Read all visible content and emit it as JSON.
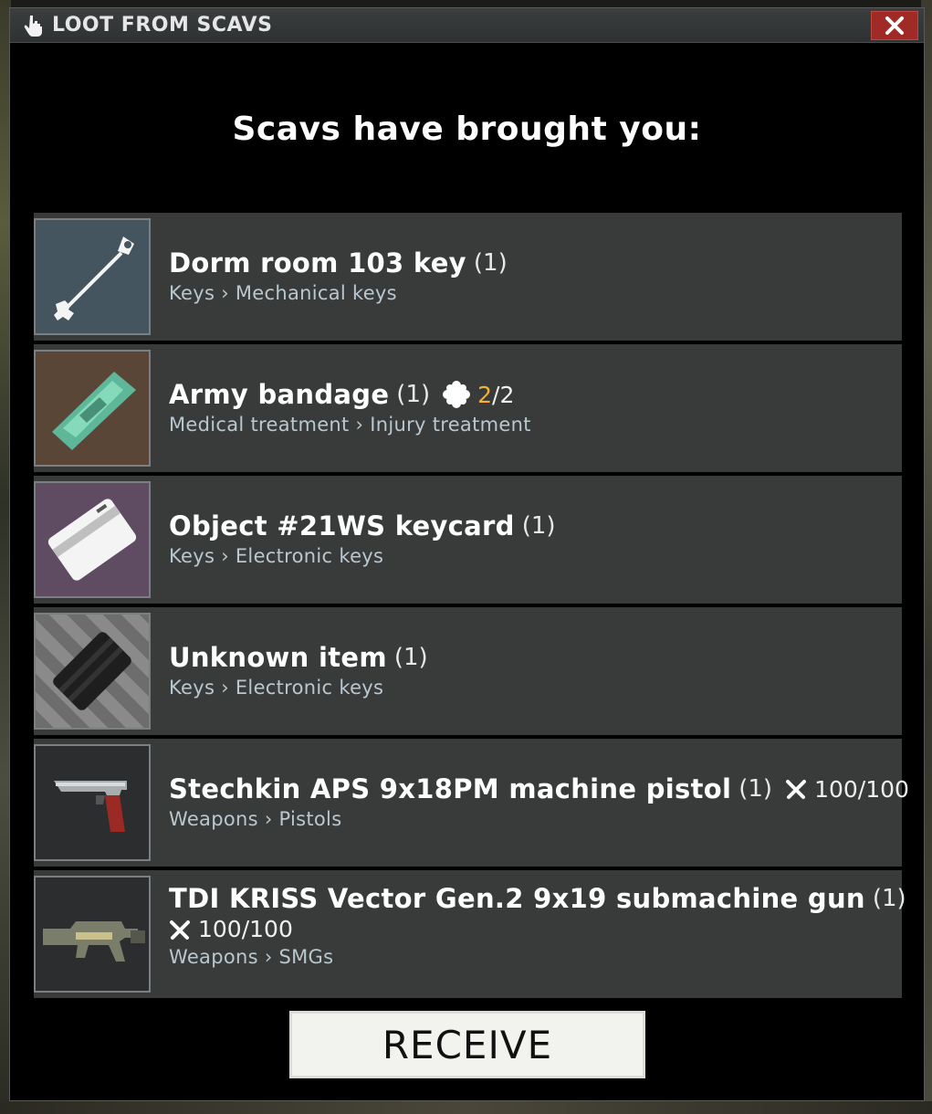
{
  "window": {
    "title": "LOOT FROM SCAVS",
    "heading": "Scavs have brought you:"
  },
  "items": [
    {
      "name": "Dorm room 103 key",
      "count": "(1)",
      "category": "Keys › Mechanical keys",
      "icon": "key-icon"
    },
    {
      "name": "Army bandage",
      "count": "(1)",
      "category": "Medical treatment › Injury treatment",
      "icon": "bandage-icon",
      "uses_current": "2",
      "uses_total": "/2"
    },
    {
      "name": "Object #21WS keycard",
      "count": "(1)",
      "category": "Keys › Electronic keys",
      "icon": "keycard-icon"
    },
    {
      "name": "Unknown item",
      "count": "(1)",
      "category": "Keys › Electronic keys",
      "icon": "unknown-item-icon"
    },
    {
      "name": "Stechkin APS 9x18PM machine pistol",
      "count": "(1)",
      "category": "Weapons › Pistols",
      "icon": "pistol-icon",
      "durability": "100/100"
    },
    {
      "name": "TDI KRISS Vector Gen.2 9x19 submachine gun",
      "count": "(1)",
      "category": "Weapons › SMGs",
      "icon": "smg-icon",
      "durability": "100/100"
    }
  ],
  "actions": {
    "receive_label": "RECEIVE"
  },
  "colors": {
    "accent_uses": "#f5b030",
    "close_button": "#a02a25",
    "row_background": "#393b3b"
  }
}
